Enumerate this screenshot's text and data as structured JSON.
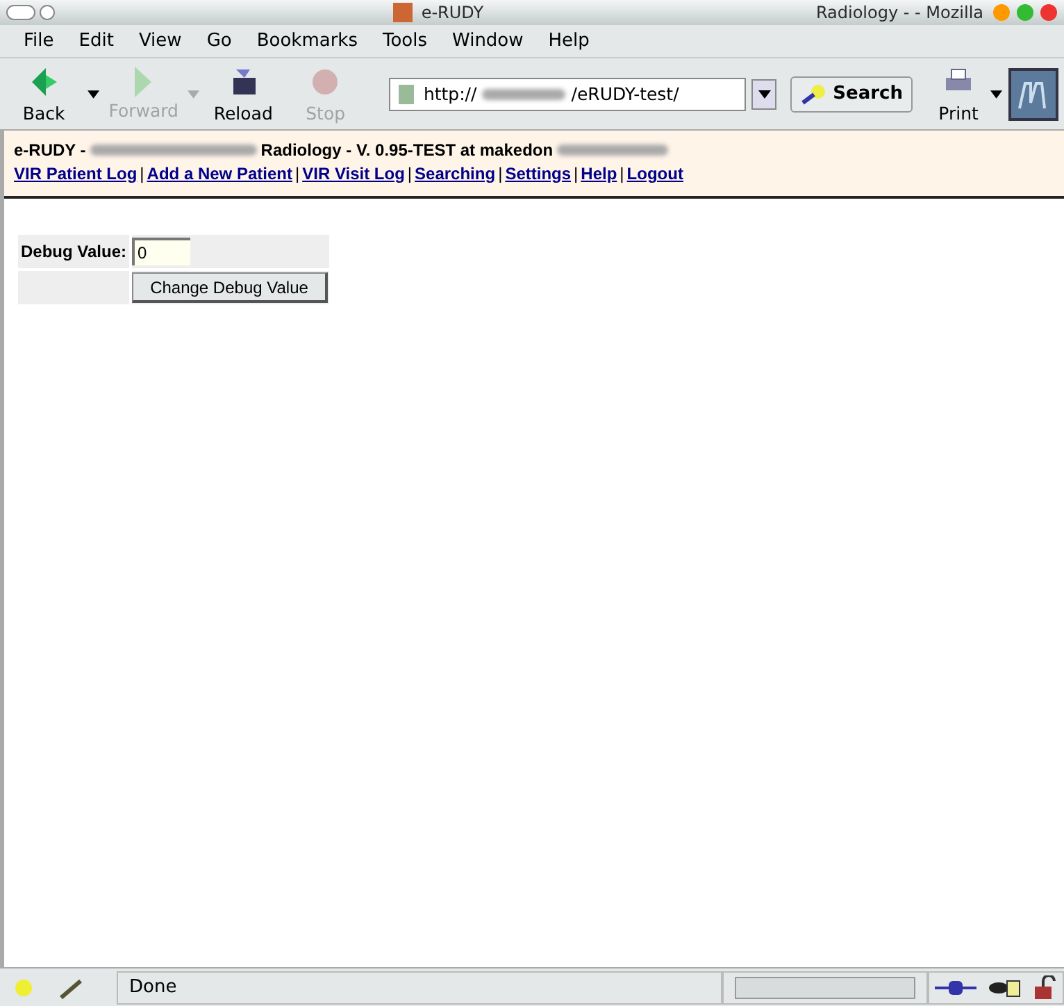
{
  "window": {
    "title_left": "e-RUDY",
    "title_right": "Radiology - - Mozilla"
  },
  "menu": [
    "File",
    "Edit",
    "View",
    "Go",
    "Bookmarks",
    "Tools",
    "Window",
    "Help"
  ],
  "toolbar": [
    {
      "label": "Back",
      "kind": "back",
      "disabled": false,
      "dropdown": true
    },
    {
      "label": "Forward",
      "kind": "forward",
      "disabled": true,
      "dropdown": true
    },
    {
      "label": "Reload",
      "kind": "reload",
      "disabled": false,
      "dropdown": false
    },
    {
      "label": "Stop",
      "kind": "stop",
      "disabled": true,
      "dropdown": false
    }
  ],
  "address": {
    "prefix": "http://",
    "suffix": "/eRUDY-test/"
  },
  "search_button": "Search",
  "print_button": "Print",
  "header": {
    "title_start": "e-RUDY -",
    "title_end": "Radiology - V. 0.95-TEST at makedon"
  },
  "nav_links": [
    "VIR Patient Log",
    "Add a New Patient",
    "VIR Visit Log",
    "Searching",
    "Settings",
    "Help",
    "Logout"
  ],
  "separator": "|",
  "form": {
    "label": "Debug Value:",
    "value": "0",
    "button": "Change Debug Value"
  },
  "status_bar": {
    "text": "Done",
    "progress": {
      "level": 0
    }
  }
}
